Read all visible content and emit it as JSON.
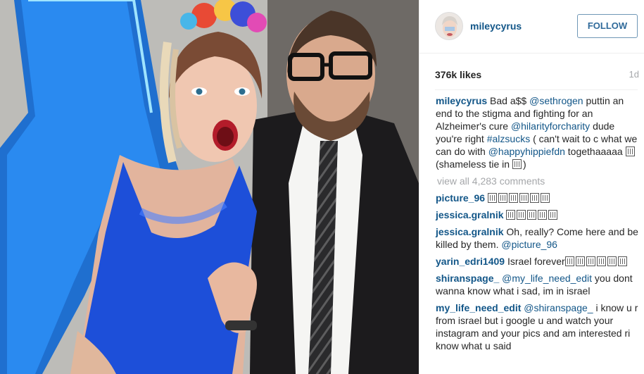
{
  "post": {
    "photo_alt": "Photo",
    "author": "mileycyrus",
    "follow_label": "FOLLOW",
    "likes": "376k likes",
    "age": "1d"
  },
  "caption": {
    "user": "mileycyrus",
    "t1": " Bad a$$ ",
    "m1": "@sethrogen",
    "t2": " puttin an end to the stigma and fighting for an Alzheimer's cure ",
    "m2": "@hilarityforcharity",
    "t3": " dude you're right ",
    "h1": "#alzsucks",
    "t4": " ( can't wait to c what we can do with ",
    "m3": "@happyhippiefdn",
    "t5": " togethaaaaa ",
    "t6": " (shameless tie in ",
    "t7": ")"
  },
  "view_all": "view all 4,283 comments",
  "comments": [
    {
      "user": "picture_96",
      "text": ""
    },
    {
      "user": "jessica.gralnik",
      "text": ""
    },
    {
      "user": "jessica.gralnik",
      "text": " Oh, really? Come here and be killed by them. ",
      "mention": "@picture_96"
    },
    {
      "user": "yarin_edri1409",
      "text": " Israel forever"
    },
    {
      "user": "shiranspage_",
      "mention": "@my_life_need_edit",
      "text": " you dont wanna know what i sad, im in israel"
    },
    {
      "user": "my_life_need_edit",
      "mention": "@shiranspage_",
      "text": " i know u r from israel but i google u and watch your instagram and your pics and am interested ri know what u said"
    }
  ],
  "colors": {
    "link": "#125688",
    "muted": "#a5a7aa",
    "follow_border": "#6f97b6"
  },
  "icons": [
    "unrendered-emoji-glyph"
  ]
}
